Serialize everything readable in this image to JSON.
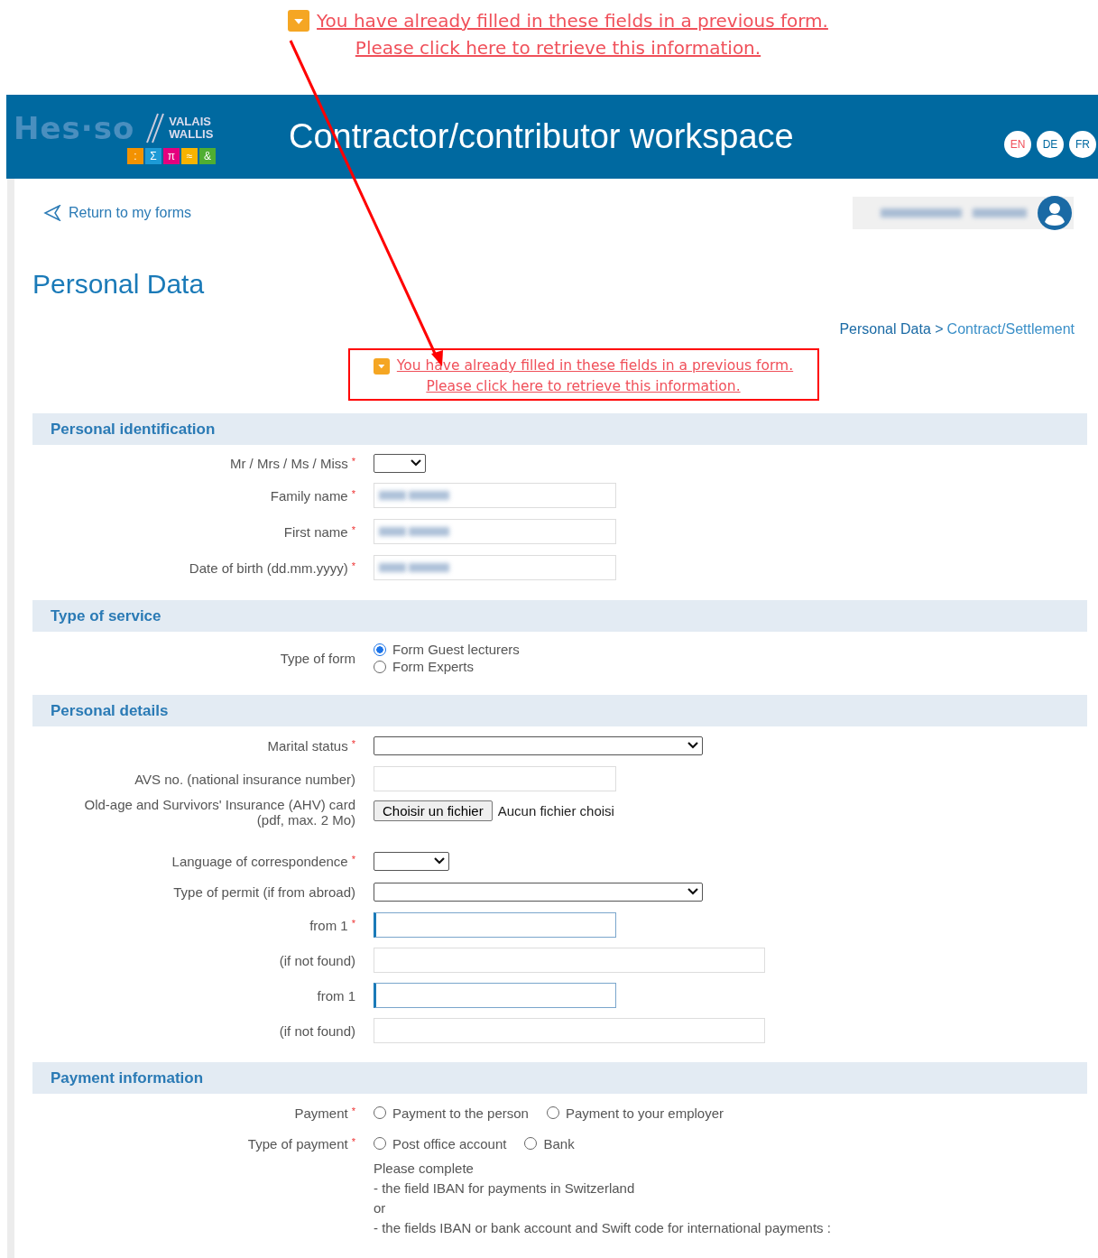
{
  "top_notice": {
    "lines": [
      "You have already filled in these fields in a previous form.",
      "Please click here to retrieve this information."
    ]
  },
  "header": {
    "logo": {
      "name": "Hes·so",
      "region_lines": [
        "VALAIS",
        "WALLIS"
      ],
      "symbols": [
        {
          "text": ":",
          "color": "#f39200"
        },
        {
          "text": "Σ",
          "color": "#1d9ad6"
        },
        {
          "text": "π",
          "color": "#e5007e"
        },
        {
          "text": "≈",
          "color": "#f8b300"
        },
        {
          "text": "&",
          "color": "#4fae32"
        }
      ]
    },
    "title": "Contractor/contributor workspace",
    "languages": [
      {
        "label": "EN",
        "selected": true
      },
      {
        "label": "DE",
        "selected": false
      },
      {
        "label": "FR",
        "selected": false
      }
    ]
  },
  "back_link": "Return to my forms",
  "user": {
    "name_blurred": true
  },
  "page_title": "Personal Data",
  "breadcrumb": [
    {
      "label": "Personal Data >",
      "selected": true
    },
    {
      "label": "Contract/Settlement",
      "selected": false
    }
  ],
  "notice": {
    "highlighted": true,
    "lines": [
      "You have already filled in these fields in a previous form.",
      "Please click here to retrieve this information."
    ]
  },
  "sections": [
    {
      "title": "Personal identification",
      "rows": [
        {
          "kind": "tinyselect",
          "label": "Mr / Mrs / Ms / Miss",
          "required_mark": "*"
        },
        {
          "kind": "text",
          "label": "Family name",
          "required_mark": "*",
          "blurred": true,
          "focused": false
        },
        {
          "kind": "text",
          "label": "First name",
          "required_mark": "*",
          "blurred": true,
          "focused": false
        },
        {
          "kind": "text",
          "label": "Date of birth (dd.mm.yyyy)",
          "required_mark": "*",
          "blurred": true,
          "focused": false
        }
      ]
    },
    {
      "title": "Type of service",
      "rows": [
        {
          "kind": "radiostack",
          "label": "Type of form",
          "options": [
            {
              "label": "Form Guest lecturers",
              "selected": true
            },
            {
              "label": "Form Experts",
              "selected": false
            }
          ]
        }
      ]
    },
    {
      "title": "Personal details",
      "rows": [
        {
          "kind": "wideselect",
          "label": "Marital status",
          "required_mark": "*"
        },
        {
          "kind": "text",
          "label": "AVS no. (national insurance number)",
          "focused": false
        },
        {
          "kind": "file",
          "label": "Old-age and Survivors' Insurance (AHV) card",
          "sublabel": "(pdf, max. 2 Mo)",
          "button": "Choisir un fichier",
          "status": "Aucun fichier choisi"
        },
        {
          "kind": "select",
          "label": "Language of correspondence",
          "required_mark": "*"
        },
        {
          "kind": "wideselect",
          "label": "Type of permit (if from abroad)"
        },
        {
          "kind": "text",
          "label": "from 1",
          "required_mark": "*",
          "focused": true
        },
        {
          "kind": "widetext",
          "label": "(if not found)",
          "focused": false
        },
        {
          "kind": "text",
          "label": "from 1",
          "focused": true
        },
        {
          "kind": "widetext",
          "label": "(if not found)",
          "focused": false
        }
      ]
    },
    {
      "title": "Payment information",
      "rows": [
        {
          "kind": "radio",
          "label": "Payment",
          "required_mark": "*",
          "options": [
            {
              "label": "Payment to the person",
              "selected": false
            },
            {
              "label": "Payment to your employer",
              "selected": false
            }
          ]
        },
        {
          "kind": "radio",
          "label": "Type of payment",
          "required_mark": "*",
          "options": [
            {
              "label": "Post office account",
              "selected": false
            },
            {
              "label": "Bank",
              "selected": false
            }
          ]
        },
        {
          "kind": "note",
          "lines": [
            "Please complete",
            "- the field IBAN for payments in Switzerland",
            "or",
            "- the fields IBAN or bank account and Swift code for international payments :"
          ]
        }
      ]
    }
  ]
}
